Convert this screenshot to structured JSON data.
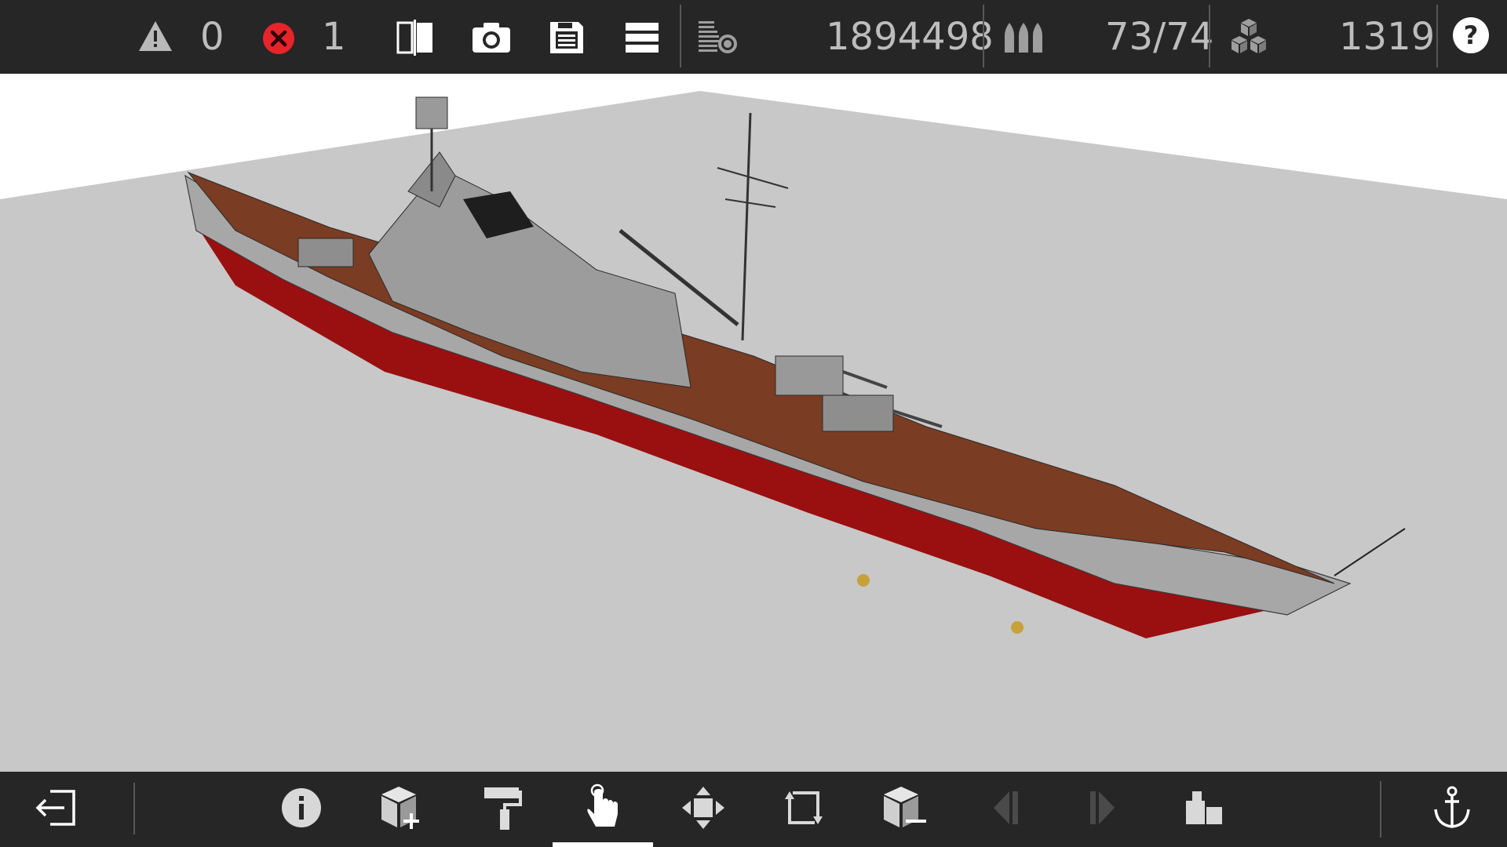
{
  "topbar": {
    "warnings": {
      "icon": "warning-triangle-icon",
      "count": "0"
    },
    "errors": {
      "icon": "error-x-icon",
      "count": "1",
      "color": "#e8242b"
    },
    "buttons": [
      {
        "id": "mirror",
        "icon": "symmetry-mirror-icon"
      },
      {
        "id": "screenshot",
        "icon": "camera-icon"
      },
      {
        "id": "save",
        "icon": "floppy-save-icon"
      },
      {
        "id": "layers",
        "icon": "layers-menu-icon"
      }
    ],
    "stats": {
      "cost": {
        "icon": "cost-coins-icon",
        "value": "1894498"
      },
      "ammo": {
        "icon": "shells-ammo-icon",
        "value": "73/74"
      },
      "parts": {
        "icon": "blocks-count-icon",
        "value": "1319"
      }
    },
    "help": {
      "icon": "help-question-icon",
      "label": "?"
    }
  },
  "viewport": {
    "subject": "battleship-model",
    "colors": {
      "deck": "#7a3c22",
      "hull": "#a7a7a7",
      "lower_hull": "#9a0f10",
      "ground": "#c8c8c8"
    }
  },
  "toolbar": {
    "exit": {
      "icon": "exit-door-icon"
    },
    "tools": [
      {
        "id": "info",
        "icon": "info-icon"
      },
      {
        "id": "add-part",
        "icon": "add-block-icon"
      },
      {
        "id": "paint",
        "icon": "paint-roller-icon"
      },
      {
        "id": "select",
        "icon": "hand-pointer-icon",
        "active": true
      },
      {
        "id": "move",
        "icon": "move-arrows-icon"
      },
      {
        "id": "rotate",
        "icon": "rotate-frame-icon"
      },
      {
        "id": "remove-part",
        "icon": "remove-block-icon"
      },
      {
        "id": "undo",
        "icon": "step-back-icon",
        "disabled": true
      },
      {
        "id": "redo",
        "icon": "step-forward-icon",
        "disabled": true
      },
      {
        "id": "group",
        "icon": "folder-group-icon"
      }
    ],
    "anchor": {
      "icon": "anchor-icon"
    }
  }
}
